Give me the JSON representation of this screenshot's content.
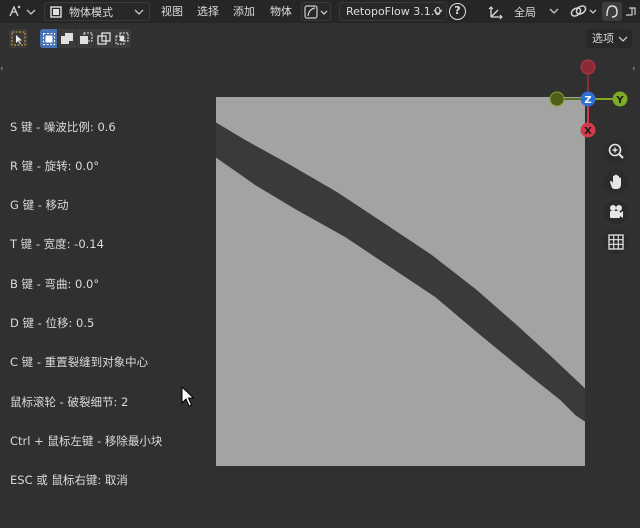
{
  "header": {
    "mode_label": "物体模式",
    "menus": [
      "视图",
      "选择",
      "添加",
      "物体"
    ],
    "addon_label": "RetopoFlow 3.1.0",
    "transform_label": "全局"
  },
  "toolbar": {
    "options_label": "选项"
  },
  "hints": [
    "S 键 - 噪波比例:  0.6",
    "R 键 - 旋转:  0.0°",
    "G 键 - 移动",
    "T 键 - 宽度:  -0.14",
    "B 键 - 弯曲:  0.0°",
    "D 键 - 位移:  0.5",
    "C 键 - 重置裂缝到对象中心",
    "鼠标滚轮 - 破裂细节:  2",
    "Ctrl + 鼠标左键 - 移除最小块",
    "ESC 或 鼠标右键: 取消"
  ],
  "gizmo": {
    "z_label": "Z",
    "y_label": "Y",
    "x_label": "X",
    "z_color": "#2e6fd4",
    "y_color": "#7dab23",
    "x_color": "#d33b4c",
    "neg_x_color": "#8c2a36",
    "neg_y_color": "#5a6e1c"
  },
  "colors": {
    "background": "#303030",
    "header": "#262626",
    "plane": "#a3a3a3",
    "crack": "#3a3a3a",
    "accent": "#4772b3"
  }
}
